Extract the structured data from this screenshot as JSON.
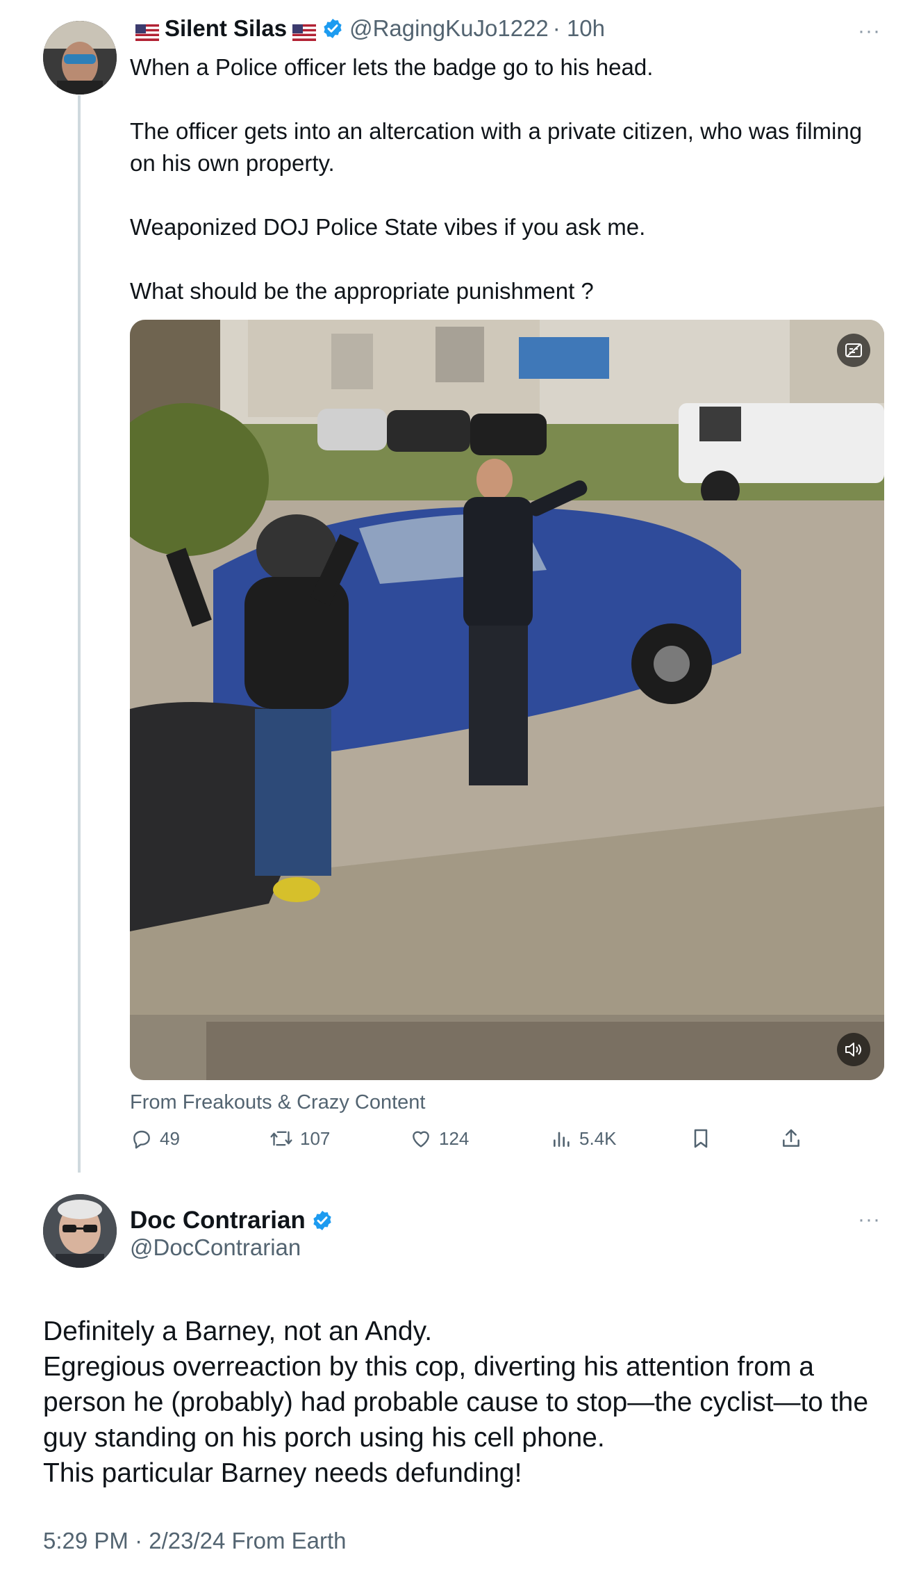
{
  "tweet": {
    "author_name": "Silent Silas",
    "handle": "@RagingKuJo1222",
    "time": "· 10h",
    "more_label": "···",
    "text": "When a Police officer lets the badge go to his head.\n\nThe officer gets into an altercation with a private citizen, who was filming on his own property.\n\nWeaponized DOJ Police State vibes if you ask me.\n\nWhat should be the appropriate punishment ?",
    "source": "From Freakouts & Crazy Content",
    "actions": {
      "replies": "49",
      "reposts": "107",
      "likes": "124",
      "views": "5.4K"
    }
  },
  "reply": {
    "author_name": "Doc Contrarian",
    "handle": "@DocContrarian",
    "more_label": "···",
    "text": "Definitely a Barney, not an Andy.\nEgregious overreaction by this cop, diverting his attention from a person he (probably) had probable cause to stop—the cyclist—to the guy standing on his porch using his cell phone.\nThis particular Barney needs defunding!",
    "timestamp": "5:29 PM · 2/23/24 From Earth"
  },
  "colors": {
    "verified": "#1d9bf0",
    "text": "#0f1419",
    "secondary": "#536471",
    "thread_line": "#cfd9de"
  },
  "icons": [
    "flag-icon",
    "verified-icon",
    "more-icon",
    "reply-icon",
    "repost-icon",
    "like-icon",
    "views-icon",
    "bookmark-icon",
    "share-icon",
    "captions-icon",
    "volume-icon"
  ]
}
